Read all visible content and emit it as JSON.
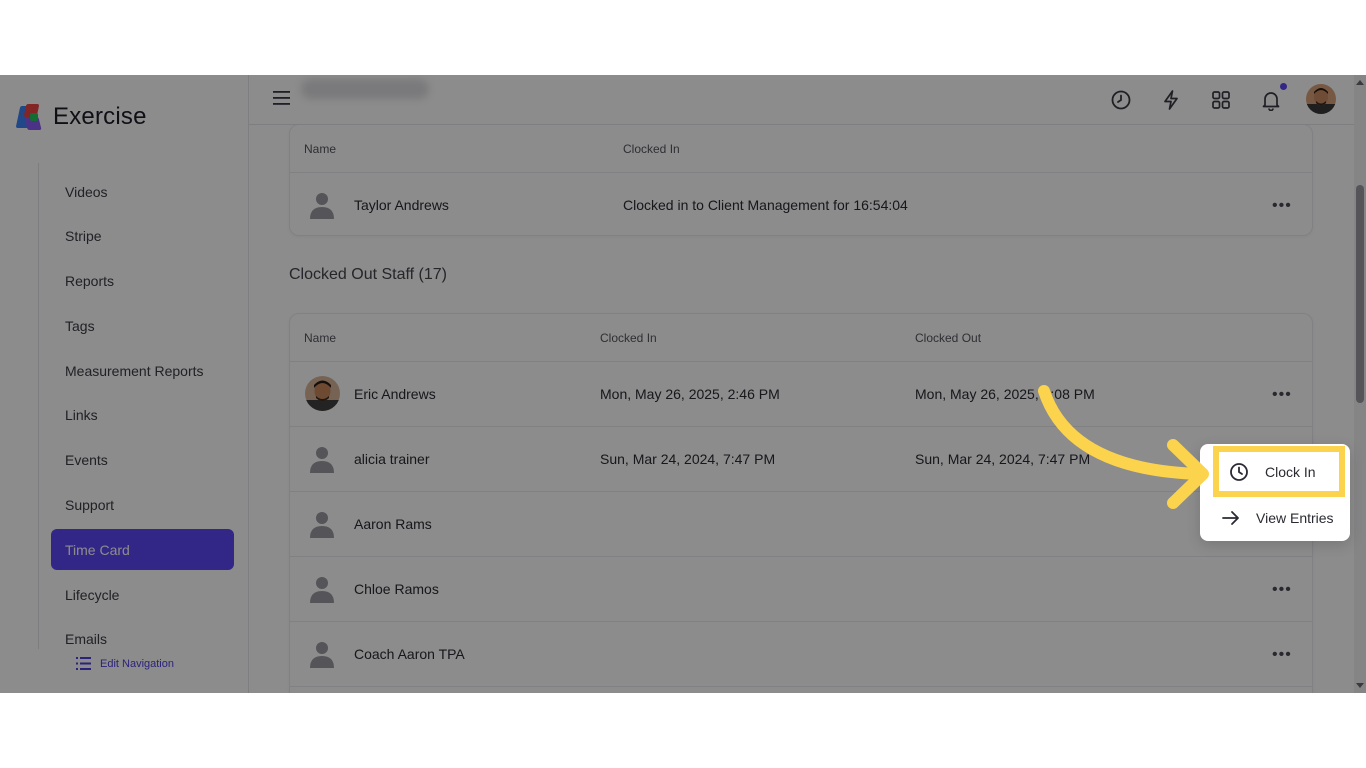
{
  "app": {
    "name": "Exercise"
  },
  "sidebar": {
    "items": [
      {
        "label": "Videos"
      },
      {
        "label": "Stripe"
      },
      {
        "label": "Reports"
      },
      {
        "label": "Tags"
      },
      {
        "label": "Measurement Reports"
      },
      {
        "label": "Links"
      },
      {
        "label": "Events"
      },
      {
        "label": "Support"
      },
      {
        "label": "Time Card",
        "active": true
      },
      {
        "label": "Lifecycle"
      },
      {
        "label": "Emails"
      }
    ],
    "edit_navigation": "Edit Navigation"
  },
  "topbar": {
    "icons": [
      "menu-icon",
      "clock-icon",
      "lightning-icon",
      "grid-icon",
      "bell-icon",
      "user-avatar"
    ],
    "notification_dot_color": "#5b47f6"
  },
  "clocked_in_table": {
    "headers": {
      "name": "Name",
      "clocked_in": "Clocked In"
    },
    "rows": [
      {
        "name": "Taylor Andrews",
        "clocked_in": "Clocked in to Client Management for 16:54:04"
      }
    ]
  },
  "clocked_out_section": {
    "title": "Clocked Out Staff (17)"
  },
  "clocked_out_table": {
    "headers": {
      "name": "Name",
      "clocked_in": "Clocked In",
      "clocked_out": "Clocked Out"
    },
    "rows": [
      {
        "name": "Eric Andrews",
        "clocked_in": "Mon, May 26, 2025, 2:46 PM",
        "clocked_out": "Mon, May 26, 2025, 3:08 PM",
        "avatar": "photo"
      },
      {
        "name": "alicia trainer",
        "clocked_in": "Sun, Mar 24, 2024, 7:47 PM",
        "clocked_out": "Sun, Mar 24, 2024, 7:47 PM",
        "avatar": "placeholder"
      },
      {
        "name": "Aaron Rams",
        "clocked_in": "",
        "clocked_out": "",
        "avatar": "placeholder"
      },
      {
        "name": "Chloe Ramos",
        "clocked_in": "",
        "clocked_out": "",
        "avatar": "placeholder"
      },
      {
        "name": "Coach Aaron TPA",
        "clocked_in": "",
        "clocked_out": "",
        "avatar": "placeholder"
      }
    ]
  },
  "row_menu": {
    "items": [
      {
        "label": "Clock In",
        "icon": "clock-icon",
        "highlighted": true
      },
      {
        "label": "View Entries",
        "icon": "arrow-right-icon"
      }
    ]
  },
  "colors": {
    "accent": "#5b47f6",
    "highlight": "#fcd34d"
  }
}
